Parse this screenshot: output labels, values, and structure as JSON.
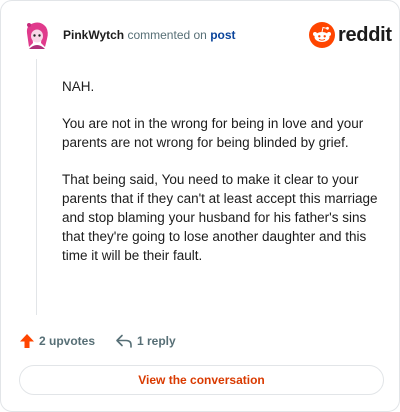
{
  "comment": {
    "author": "PinkWytch",
    "action_text": "commented on",
    "target_link": "post",
    "paragraphs": [
      "NAH.",
      "You are not in the wrong for being in love and your parents are not wrong for being blinded by grief.",
      "That being said, You need to make it clear to your parents that if they can't at least accept this marriage and stop blaming your husband for his father's sins that they're going to lose another daughter and this time it will be their fault."
    ]
  },
  "brand": {
    "name": "reddit",
    "logo_icon": "reddit-logo-icon",
    "color": "#ff4500"
  },
  "actions": {
    "upvotes_label": "2 upvotes",
    "upvote_icon": "upvote-arrow-icon",
    "replies_label": "1 reply",
    "reply_icon": "reply-arrow-icon"
  },
  "cta": {
    "label": "View the conversation",
    "color": "#d93a00"
  },
  "colors": {
    "link": "#0a449b",
    "muted": "#576f76",
    "border": "#e2e5e8",
    "upvote": "#ff4500"
  }
}
